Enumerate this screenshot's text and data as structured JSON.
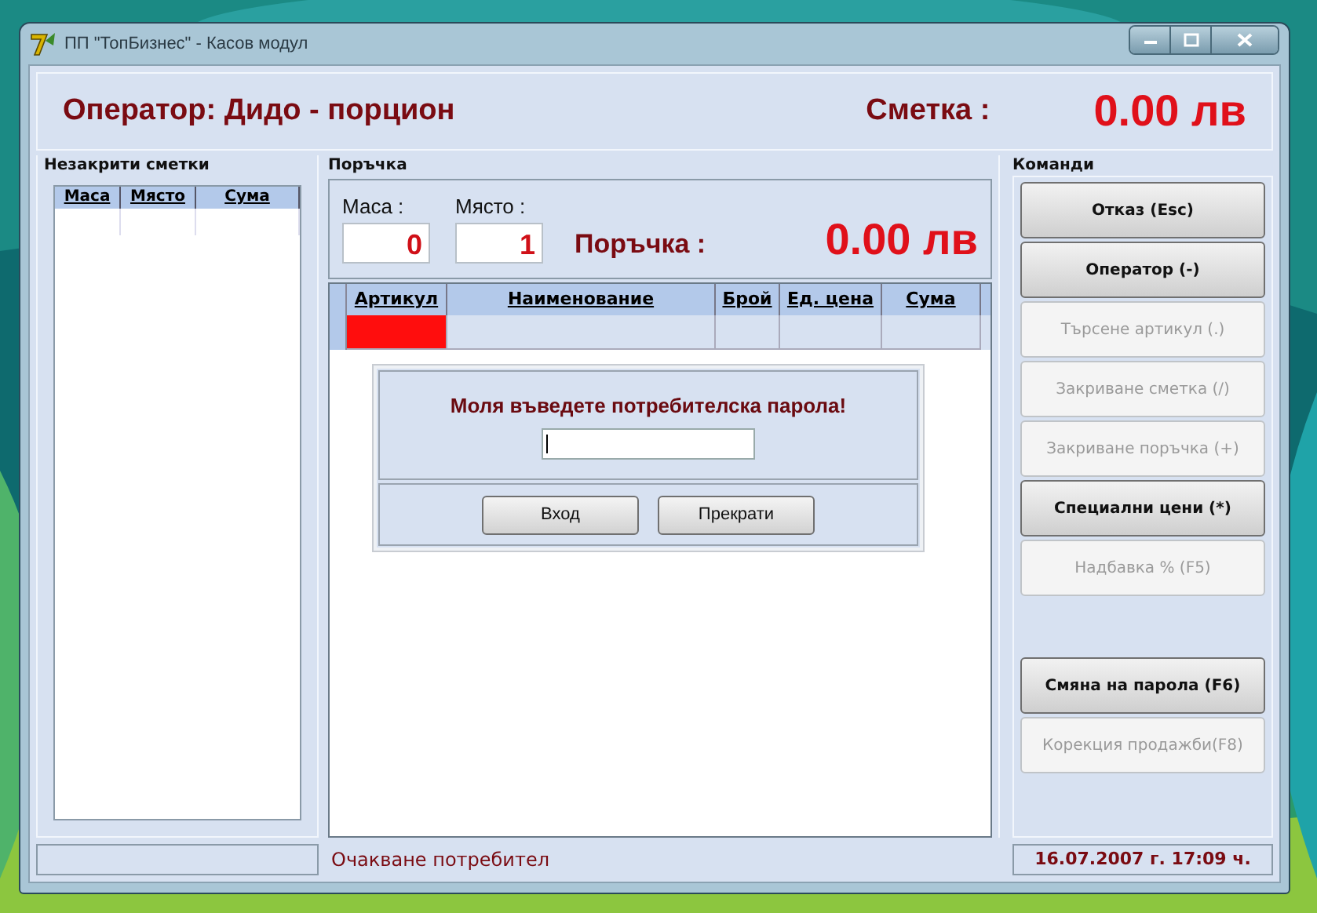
{
  "window": {
    "title": "ПП \"ТопБизнес\" - Касов модул"
  },
  "header": {
    "operator": "Оператор: Дидо - порцион",
    "bill_label": "Сметка :",
    "bill_amount": "0.00 лв"
  },
  "open_bills": {
    "title": "Незакрити сметки",
    "columns": [
      "Маса",
      "Място",
      "Сума"
    ]
  },
  "order": {
    "title": "Поръчка",
    "table_label": "Маса :",
    "table_value": "0",
    "seat_label": "Място :",
    "seat_value": "1",
    "order_label": "Поръчка :",
    "order_amount": "0.00 лв",
    "columns": [
      "Артикул",
      "Наименование",
      "Брой",
      "Ед. цена",
      "Сума"
    ],
    "rows": [
      {
        "selected": true
      }
    ]
  },
  "login_dialog": {
    "message": "Моля въведете потребителска парола!",
    "password": {
      "focused": true
    },
    "buttons": [
      "Вход",
      "Прекрати"
    ]
  },
  "commands": {
    "title": "Команди",
    "groups": [
      [
        {
          "label": "Отказ  (Esc)",
          "disabled": false
        },
        {
          "label": "Оператор (-)",
          "disabled": false
        },
        {
          "label": "Търсене артикул  (.)",
          "disabled": true
        },
        {
          "label": "Закриване сметка (/)",
          "disabled": true
        },
        {
          "label": "Закриване поръчка (+)",
          "disabled": true
        },
        {
          "label": "Специални цени  (*)",
          "disabled": false
        },
        {
          "label": "Надбавка % (F5)",
          "disabled": true
        }
      ],
      [
        {
          "label": "Смяна на парола (F6)",
          "disabled": false
        },
        {
          "label": "Корекция продажби(F8)",
          "disabled": true
        }
      ]
    ]
  },
  "status_bar": {
    "message": "Очакване потребител",
    "datetime": "16.07.2007 г. 17:09 ч."
  }
}
